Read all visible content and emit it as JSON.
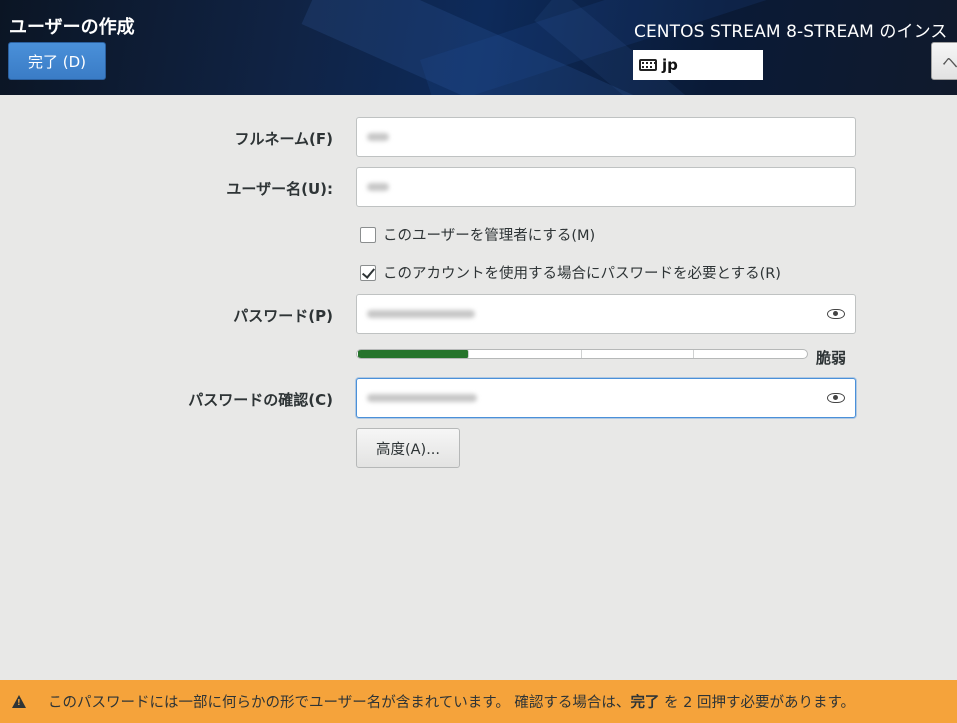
{
  "header": {
    "page_title": "ユーザーの作成",
    "done_button_label": "完了 (D)",
    "product_title": "CENTOS STREAM 8-STREAM のインス",
    "keyboard_layout": "jp",
    "help_button_glyph": "ヘ"
  },
  "form": {
    "full_name": {
      "label": "フルネーム(F)",
      "value": "•••"
    },
    "user_name": {
      "label": "ユーザー名(U):",
      "value": "•••"
    },
    "admin_checkbox": {
      "label": "このユーザーを管理者にする(M)",
      "checked": false
    },
    "require_password_checkbox": {
      "label": "このアカウントを使用する場合にパスワードを必要とする(R)",
      "checked": true
    },
    "password": {
      "label": "パスワード(P)",
      "value": "••••••••••••••"
    },
    "password_strength": {
      "label": "脆弱",
      "level": 0.25,
      "segments": 4,
      "color": "#26742c"
    },
    "confirm_password": {
      "label": "パスワードの確認(C)",
      "value": "••••••••••••••"
    },
    "advanced_button_label": "高度(A)..."
  },
  "warning": {
    "text_before": "このパスワードには一部に何らかの形でユーザー名が含まれています。 確認する場合は、",
    "emphasis": "完了",
    "text_after": "を 2 回押す必要があります。",
    "color": "#f5a33b",
    "icon": "warning-icon"
  },
  "colors": {
    "accent": "#4a90d9",
    "background": "#e8e8e7",
    "warning": "#f5a33b"
  }
}
